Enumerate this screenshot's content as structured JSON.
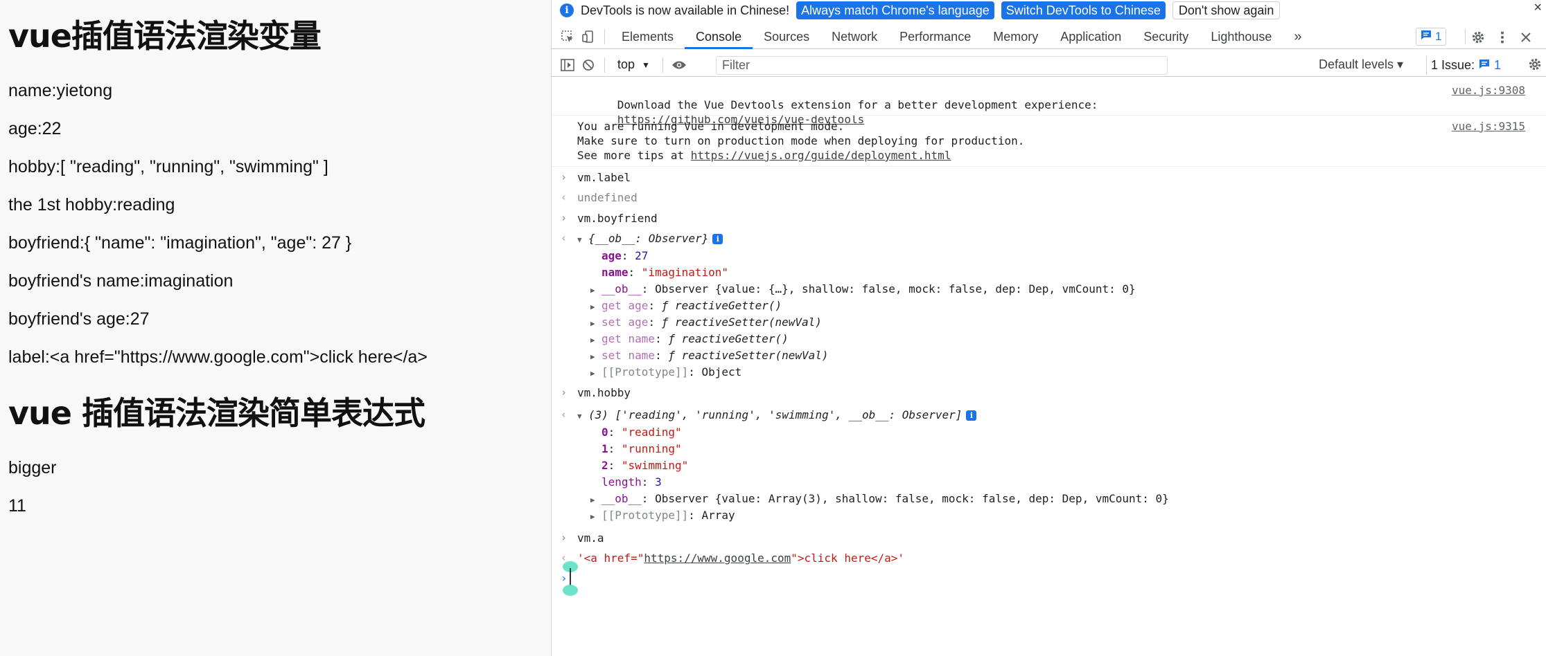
{
  "page": {
    "heading1": "vue插值语法渲染变量",
    "lines": [
      "name:yietong",
      "age:22",
      "hobby:[ \"reading\", \"running\", \"swimming\" ]",
      "the 1st hobby:reading",
      "boyfriend:{ \"name\": \"imagination\", \"age\": 27 }",
      "boyfriend's name:imagination",
      "boyfriend's age:27",
      "label:<a href=\"https://www.google.com\">click here</a>"
    ],
    "heading2": "vue 插值语法渲染简单表达式",
    "lines2": [
      "bigger",
      "11"
    ]
  },
  "infobar": {
    "message": "DevTools is now available in Chinese!",
    "btn_match": "Always match Chrome's language",
    "btn_switch": "Switch DevTools to Chinese",
    "btn_dismiss": "Don't show again",
    "close": "×"
  },
  "tabs": [
    "Elements",
    "Console",
    "Sources",
    "Network",
    "Performance",
    "Memory",
    "Application",
    "Security",
    "Lighthouse"
  ],
  "tabs_more": "»",
  "issues_badge_count": "1",
  "toolbar": {
    "context": "top",
    "filter_placeholder": "Filter",
    "levels": "Default levels ▾",
    "issue_label": "1 Issue:",
    "issue_count": "1"
  },
  "console": {
    "msg1_line1": "Download the Vue Devtools extension for a better development experience:",
    "msg1_link": "https://github.com/vuejs/vue-devtools",
    "msg1_src": "vue.js:9308",
    "msg2_line1": "You are running Vue in development mode.",
    "msg2_line2": "Make sure to turn on production mode when deploying for production.",
    "msg2_line3_prefix": "See more tips at ",
    "msg2_link": "https://vuejs.org/guide/deployment.html",
    "msg2_src": "vue.js:9315",
    "cmd_label": "vm.label",
    "res_label": "undefined",
    "cmd_boyfriend": "vm.boyfriend",
    "bf_summary": "{__ob__: Observer}",
    "bf_age_key": "age",
    "bf_age_val": "27",
    "bf_name_key": "name",
    "bf_name_val": "\"imagination\"",
    "bf_ob_key": "__ob__",
    "bf_ob_val": "Observer {value: {…}, shallow: false, mock: false, dep: Dep, vmCount: 0}",
    "bf_get_age_key": "get age",
    "bf_get_age_val": "ƒ reactiveGetter()",
    "bf_set_age_key": "set age",
    "bf_set_age_val": "ƒ reactiveSetter(newVal)",
    "bf_get_name_key": "get name",
    "bf_get_name_val": "ƒ reactiveGetter()",
    "bf_set_name_key": "set name",
    "bf_set_name_val": "ƒ reactiveSetter(newVal)",
    "bf_proto_key": "[[Prototype]]",
    "bf_proto_val": "Object",
    "cmd_hobby": "vm.hobby",
    "hobby_summary": "(3) ['reading', 'running', 'swimming', __ob__: Observer]",
    "hobby_0_key": "0",
    "hobby_0_val": "\"reading\"",
    "hobby_1_key": "1",
    "hobby_1_val": "\"running\"",
    "hobby_2_key": "2",
    "hobby_2_val": "\"swimming\"",
    "hobby_len_key": "length",
    "hobby_len_val": "3",
    "hobby_ob_key": "__ob__",
    "hobby_ob_val": "Observer {value: Array(3), shallow: false, mock: false, dep: Dep, vmCount: 0}",
    "hobby_proto_key": "[[Prototype]]",
    "hobby_proto_val": "Array",
    "cmd_a": "vm.a",
    "res_a_prefix": "'<a href=\"",
    "res_a_link": "https://www.google.com",
    "res_a_suffix": "\">click here</a>'"
  }
}
